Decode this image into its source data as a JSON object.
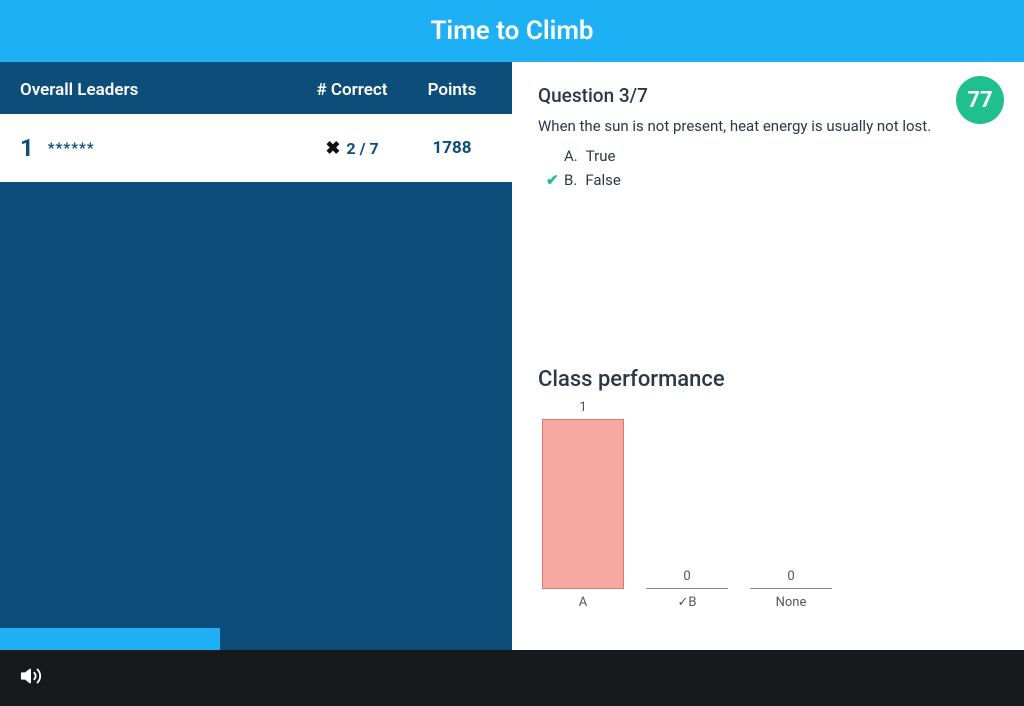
{
  "header": {
    "title": "Time to Climb"
  },
  "leaders": {
    "title": "Overall Leaders",
    "col_correct": "# Correct",
    "col_points": "Points",
    "rows": [
      {
        "rank": "1",
        "name": "******",
        "correct": "2 / 7",
        "points": "1788",
        "status": "wrong"
      }
    ]
  },
  "progress": {
    "percent": 43
  },
  "question": {
    "title": "Question 3/7",
    "text": "When the sun is not present, heat energy is usually not lost.",
    "timer": "77",
    "answers": [
      {
        "letter": "A.",
        "text": "True",
        "correct": false
      },
      {
        "letter": "B.",
        "text": "False",
        "correct": true
      }
    ]
  },
  "performance": {
    "title": "Class performance"
  },
  "chart_data": {
    "type": "bar",
    "categories": [
      "A",
      "✓B",
      "None"
    ],
    "values": [
      1,
      0,
      0
    ],
    "title": "Class performance",
    "xlabel": "",
    "ylabel": "",
    "ylim": [
      0,
      1
    ]
  }
}
